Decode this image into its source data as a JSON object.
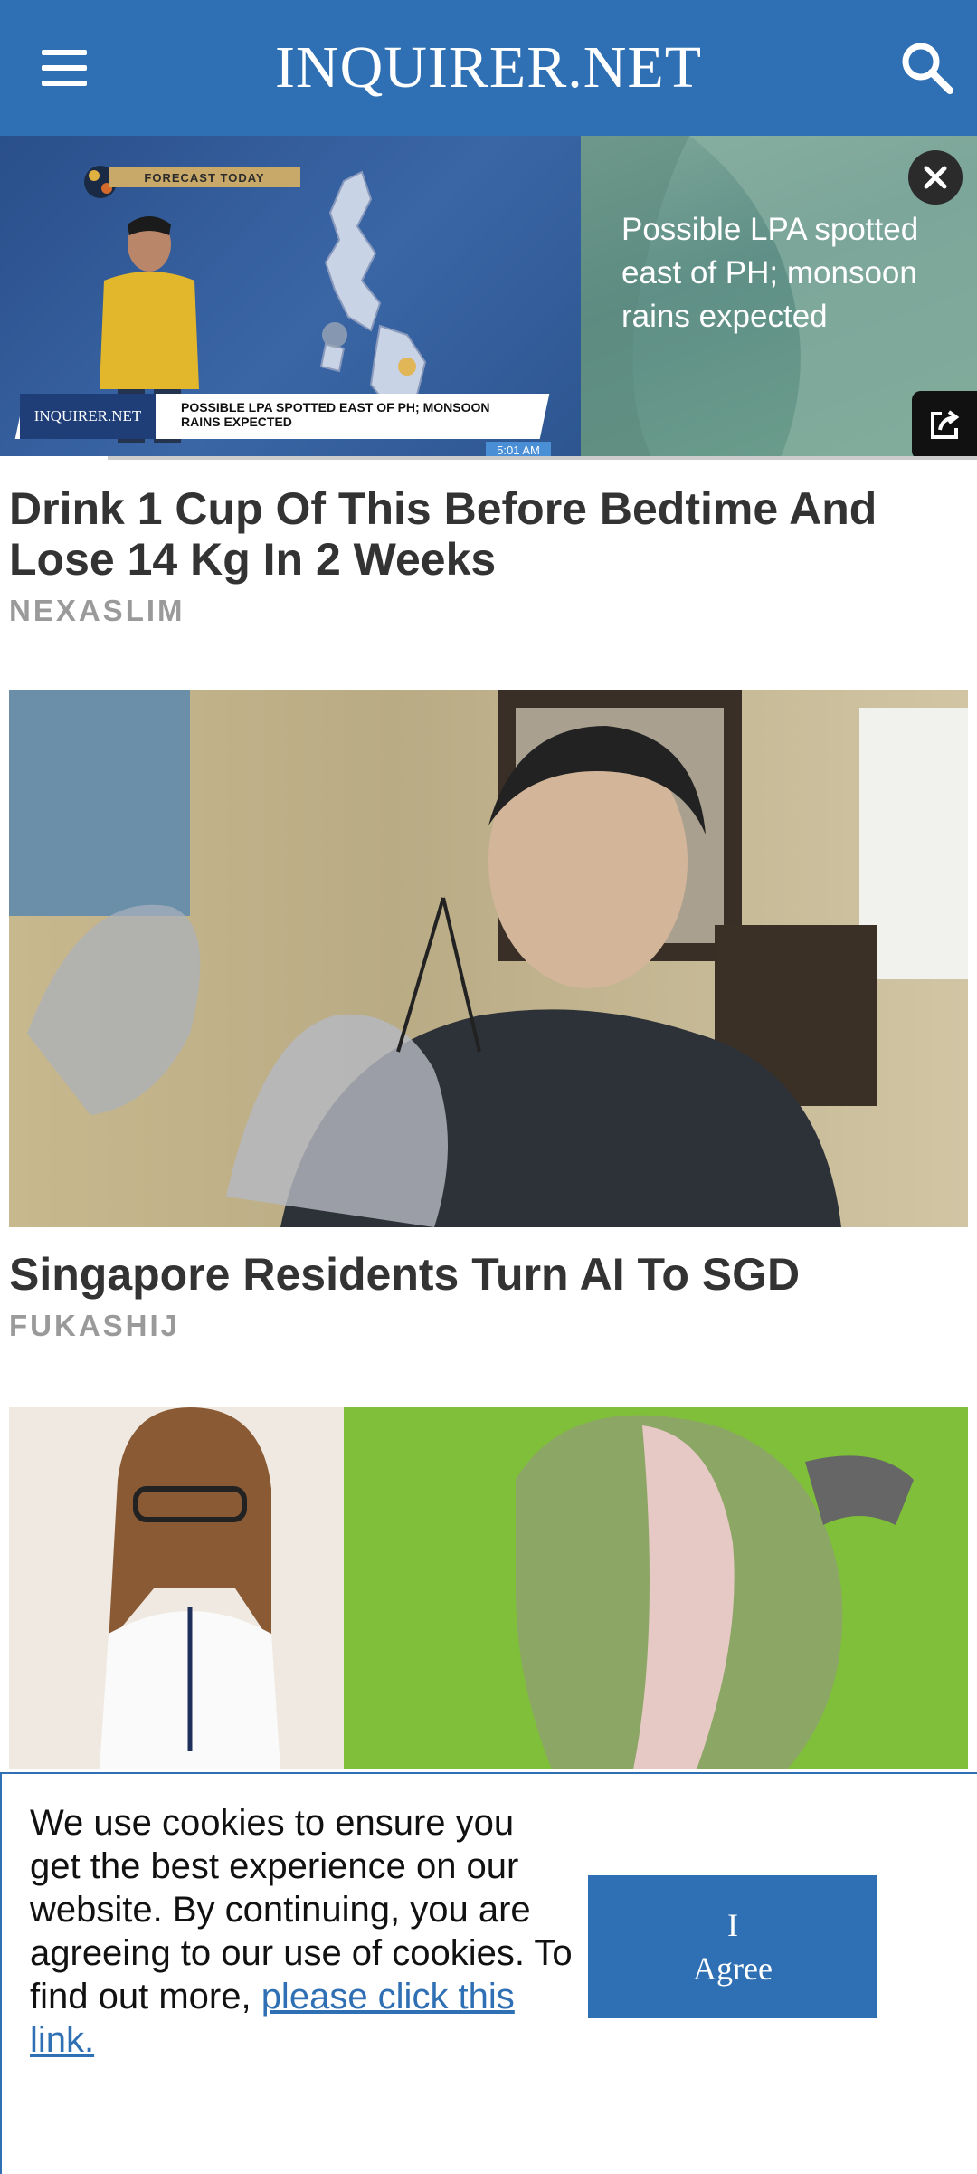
{
  "header": {
    "logo": "INQUIRER.NET",
    "menu_icon": "hamburger-menu-icon",
    "search_icon": "search-icon"
  },
  "video": {
    "forecast_tag": "FORECAST TODAY",
    "lower_third_brand": "INQUIRER.NET",
    "lower_third_text": "POSSIBLE LPA SPOTTED EAST OF PH; MONSOON RAINS EXPECTED",
    "time": "5:01 AM",
    "caption": "Possible LPA spotted east of PH; monsoon rains expected",
    "close_icon": "close-icon",
    "popout_icon": "popout-icon",
    "progress_fraction": 0.11
  },
  "articles": [
    {
      "title": "Drink 1 Cup Of This Before Bedtime And Lose 14 Kg In 2 Weeks",
      "source": "NEXASLIM"
    },
    {
      "title": "Singapore Residents Turn AI To SGD",
      "source": "FUKASHIJ"
    }
  ],
  "cookie": {
    "text": "We use cookies to ensure you get the best experience on our website. By continuing, you are agreeing to our use of cookies. To find out more, ",
    "link": "please click this link.",
    "button_line1": "I",
    "button_line2": "Agree"
  },
  "colors": {
    "brand_blue": "#2f6fb3"
  }
}
